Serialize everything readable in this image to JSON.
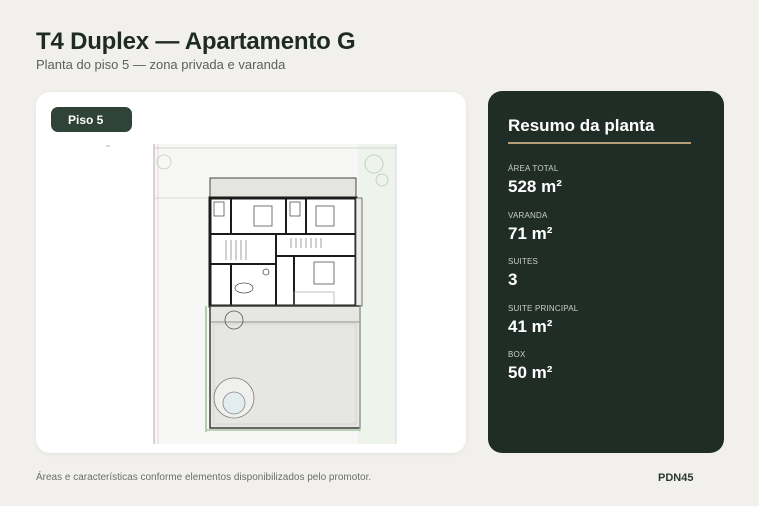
{
  "header": {
    "title": "T4 Duplex — Apartamento G",
    "subtitle": "Planta do piso 5 — zona privada e varanda"
  },
  "plan": {
    "floor_badge": "Piso 5"
  },
  "summary": {
    "title": "Resumo da planta",
    "items": [
      {
        "label": "ÁREA TOTAL",
        "value": "528 m²"
      },
      {
        "label": "VARANDA",
        "value": "71 m²"
      },
      {
        "label": "SUITES",
        "value": "3"
      },
      {
        "label": "SUITE PRINCIPAL",
        "value": "41 m²"
      },
      {
        "label": "BOX",
        "value": "50 m²"
      }
    ]
  },
  "footer": {
    "note": "Áreas e características conforme elementos disponibilizados pelo promotor.",
    "code": "PDN45"
  },
  "colors": {
    "background": "#f1f0ec",
    "panel_dark": "#202d26",
    "badge": "#2f4338",
    "accent_rule": "#b59f78"
  }
}
